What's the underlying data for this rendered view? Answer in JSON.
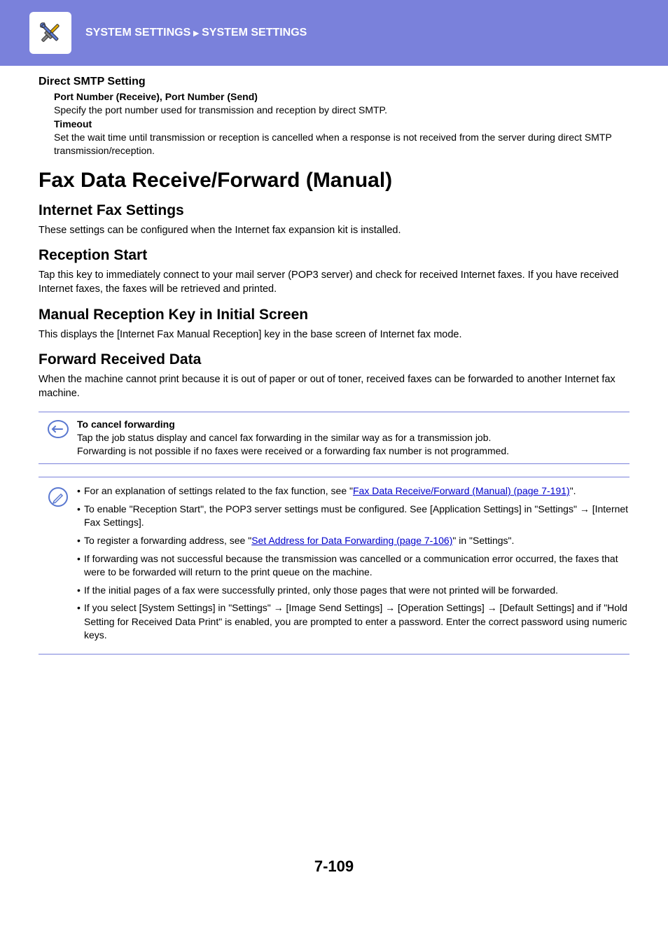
{
  "header": {
    "crumb1": "SYSTEM SETTINGS",
    "crumb2": "SYSTEM SETTINGS"
  },
  "smtp": {
    "heading": "Direct SMTP Setting",
    "sub1": "Port Number (Receive), Port Number (Send)",
    "sub1_body": "Specify the port number used for transmission and reception by direct SMTP.",
    "sub2": "Timeout",
    "sub2_body": "Set the wait time until transmission or reception is cancelled when a response is not received from the server during direct SMTP transmission/reception."
  },
  "h1": "Fax Data Receive/Forward (Manual)",
  "sections": {
    "ifax": {
      "title": "Internet Fax Settings",
      "body": "These settings can be configured when the Internet fax expansion kit is installed."
    },
    "reception": {
      "title": "Reception Start",
      "body": "Tap this key to immediately connect to your mail server (POP3 server) and check for received Internet faxes. If you have received Internet faxes, the faxes will be retrieved and printed."
    },
    "manual_key": {
      "title": "Manual Reception Key in Initial Screen",
      "body": "This displays the [Internet Fax Manual Reception] key in the base screen of Internet fax mode."
    },
    "forward": {
      "title": "Forward Received Data",
      "body": "When the machine cannot print because it is out of paper or out of toner, received faxes can be forwarded to another Internet fax machine."
    }
  },
  "cancel_note": {
    "title": "To cancel forwarding",
    "line1": "Tap the job status display and cancel fax forwarding in the similar way as for a transmission job.",
    "line2": "Forwarding is not possible if no faxes were received or a forwarding fax number is not programmed."
  },
  "info_bullets": {
    "b1_pre": "For an explanation of settings related to the fax function, see \"",
    "b1_link": "Fax Data Receive/Forward (Manual) (page 7-191)",
    "b1_post": "\".",
    "b2": "To enable \"Reception Start\", the POP3 server settings must be configured. See [Application Settings] in \"Settings\" → [Internet Fax Settings].",
    "b3_pre": "To register a forwarding address, see \"",
    "b3_link": "Set Address for Data Forwarding (page 7-106)",
    "b3_post": "\" in \"Settings\".",
    "b4": "If forwarding was not successful because the transmission was cancelled or a communication error occurred, the faxes that were to be forwarded will return to the print queue on the machine.",
    "b5": "If the initial pages of a fax were successfully printed, only those pages that were not printed will be forwarded.",
    "b6": "If you select [System Settings] in \"Settings\" → [Image Send Settings] → [Operation Settings] → [Default Settings] and if \"Hold Setting for Received Data Print\" is enabled, you are prompted to enter a password. Enter the correct password using numeric keys."
  },
  "page_number": "7-109"
}
